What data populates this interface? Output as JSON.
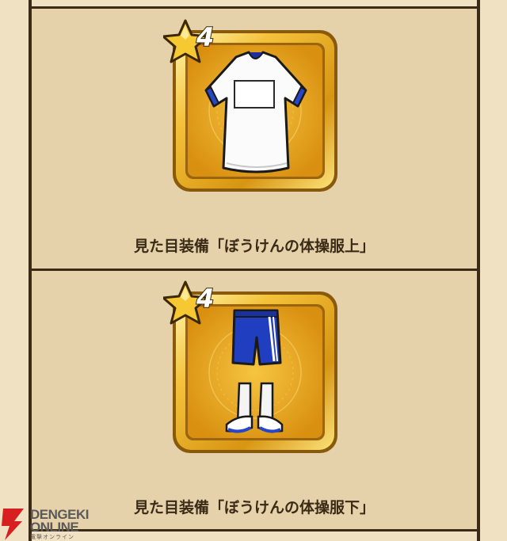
{
  "items": [
    {
      "rarity": "4",
      "title": "見た目装備「ぼうけんの体操服上」",
      "icon": "gym-shirt-icon"
    },
    {
      "rarity": "4",
      "title": "見た目装備「ぼうけんの体操服下」",
      "icon": "gym-shorts-socks-icon"
    }
  ],
  "watermark": {
    "line1": "DENGEKI",
    "line2": "ONLINE",
    "line3": "電撃オンライン"
  },
  "colors": {
    "background": "#efe1c2",
    "border": "#3b2a16",
    "frame_gold": "#e0a21e",
    "accent_blue": "#2547c8"
  }
}
